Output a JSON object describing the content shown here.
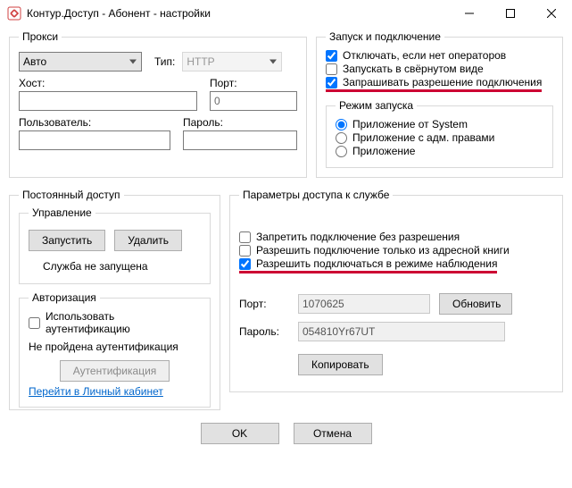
{
  "window": {
    "title": "Контур.Доступ - Абонент - настройки"
  },
  "proxy": {
    "legend": "Прокси",
    "mode": "Авто",
    "type_label": "Тип:",
    "type_value": "HTTP",
    "host_label": "Хост:",
    "host_value": "",
    "port_label": "Порт:",
    "port_value": "0",
    "user_label": "Пользователь:",
    "user_value": "",
    "pass_label": "Пароль:",
    "pass_value": ""
  },
  "startup": {
    "legend": "Запуск и подключение",
    "disconnect_no_ops": "Отключать, если нет операторов",
    "disconnect_no_ops_checked": true,
    "start_minimized": "Запускать в свёрнутом виде",
    "start_minimized_checked": false,
    "ask_permission": "Запрашивать разрешение подключения",
    "ask_permission_checked": true,
    "mode_legend": "Режим запуска",
    "mode_system": "Приложение от System",
    "mode_admin": "Приложение с адм. правами",
    "mode_app": "Приложение",
    "mode_selected": "system"
  },
  "perm": {
    "legend": "Постоянный доступ",
    "manage_legend": "Управление",
    "start_btn": "Запустить",
    "delete_btn": "Удалить",
    "status": "Служба не запущена",
    "auth_legend": "Авторизация",
    "use_auth": "Использовать аутентификацию",
    "use_auth_checked": false,
    "auth_status": "Не пройдена аутентификация",
    "auth_btn": "Аутентификация",
    "cabinet_link": "Перейти в Личный кабинет"
  },
  "params": {
    "legend": "Параметры доступа к службе",
    "deny_noperm": "Запретить подключение без разрешения",
    "deny_noperm_checked": false,
    "only_book": "Разрешить подключение только из адресной книги",
    "only_book_checked": false,
    "allow_observe": "Разрешить подключаться в режиме наблюдения",
    "allow_observe_checked": true,
    "port_label": "Порт:",
    "port_value": "1070625",
    "refresh_btn": "Обновить",
    "pass_label": "Пароль:",
    "pass_value": "054810Yr67UT",
    "copy_btn": "Копировать"
  },
  "footer": {
    "ok": "OK",
    "cancel": "Отмена"
  }
}
